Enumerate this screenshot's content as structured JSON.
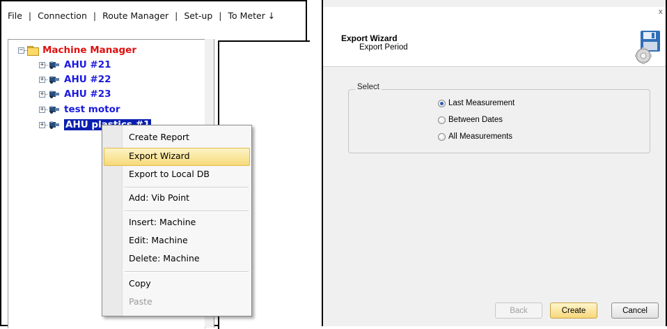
{
  "menu": {
    "items": [
      "File",
      "Connection",
      "Route Manager",
      "Set-up",
      "To Meter ↓"
    ],
    "separator": "|"
  },
  "tree": {
    "root": {
      "label": "Machine Manager",
      "expander": "−",
      "icon": "folder-icon"
    },
    "children": [
      {
        "label": "AHU #21",
        "expander": "+",
        "icon": "machine-icon"
      },
      {
        "label": "AHU #22",
        "expander": "+",
        "icon": "machine-icon"
      },
      {
        "label": "AHU #23",
        "expander": "+",
        "icon": "machine-icon"
      },
      {
        "label": "test motor",
        "expander": "+",
        "icon": "machine-icon"
      },
      {
        "label": "AHU plastics #1",
        "expander": "+",
        "icon": "machine-icon",
        "selected": true
      }
    ]
  },
  "context_menu": {
    "items": [
      {
        "label": "Create Report",
        "enabled": true
      },
      {
        "label": "Export Wizard",
        "enabled": true,
        "highlighted": true
      },
      {
        "label": "Export to Local DB",
        "enabled": true
      },
      {
        "label": "Add: Vib Point",
        "enabled": true
      },
      {
        "label": "Insert: Machine",
        "enabled": true
      },
      {
        "label": "Edit: Machine",
        "enabled": true
      },
      {
        "label": "Delete: Machine",
        "enabled": true
      },
      {
        "label": "Copy",
        "enabled": true
      },
      {
        "label": "Paste",
        "enabled": false
      }
    ]
  },
  "wizard": {
    "close": "x",
    "title": "Export Wizard",
    "subtitle": "Export Period",
    "group_label": "Select",
    "options": [
      {
        "label": "Last Measurement",
        "checked": true
      },
      {
        "label": "Between Dates",
        "checked": false
      },
      {
        "label": "All Measurements",
        "checked": false
      }
    ],
    "buttons": {
      "back": "Back",
      "create": "Create",
      "cancel": "Cancel"
    }
  },
  "colors": {
    "root_label": "#e01010",
    "node_label": "#1a1ae0",
    "selection": "#0a1fb0",
    "menu_highlight": "#f6da7a"
  }
}
